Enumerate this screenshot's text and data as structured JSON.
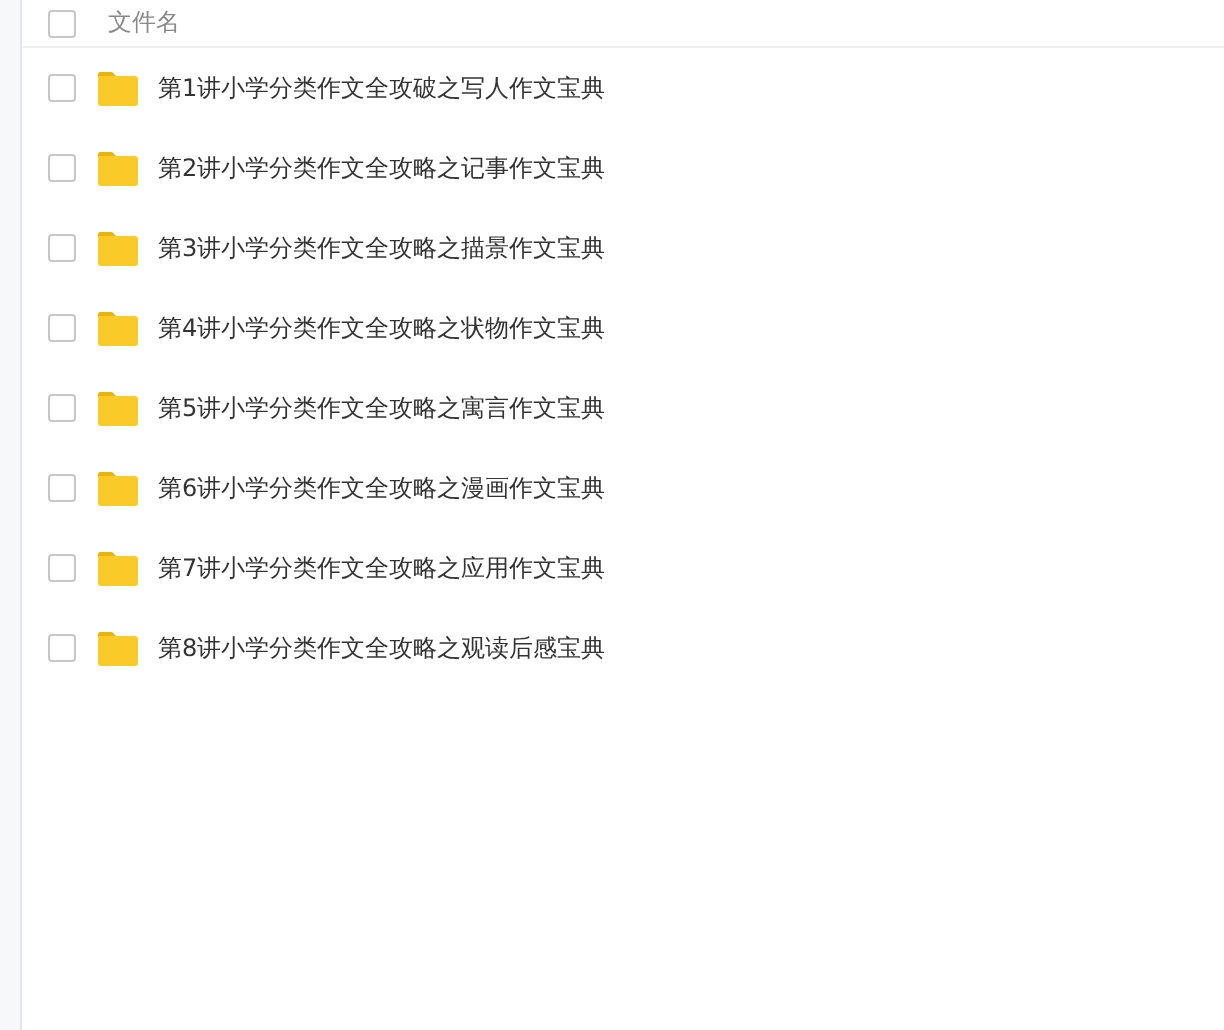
{
  "header": {
    "select_all": {
      "checked": false
    },
    "column_label": "文件名"
  },
  "files": [
    {
      "name": "第1讲小学分类作文全攻破之写人作文宝典",
      "kind": "folder",
      "checked": false
    },
    {
      "name": "第2讲小学分类作文全攻略之记事作文宝典",
      "kind": "folder",
      "checked": false
    },
    {
      "name": "第3讲小学分类作文全攻略之描景作文宝典",
      "kind": "folder",
      "checked": false
    },
    {
      "name": "第4讲小学分类作文全攻略之状物作文宝典",
      "kind": "folder",
      "checked": false
    },
    {
      "name": "第5讲小学分类作文全攻略之寓言作文宝典",
      "kind": "folder",
      "checked": false
    },
    {
      "name": "第6讲小学分类作文全攻略之漫画作文宝典",
      "kind": "folder",
      "checked": false
    },
    {
      "name": "第7讲小学分类作文全攻略之应用作文宝典",
      "kind": "folder",
      "checked": false
    },
    {
      "name": "第8讲小学分类作文全攻略之观读后感宝典",
      "kind": "folder",
      "checked": false
    }
  ]
}
